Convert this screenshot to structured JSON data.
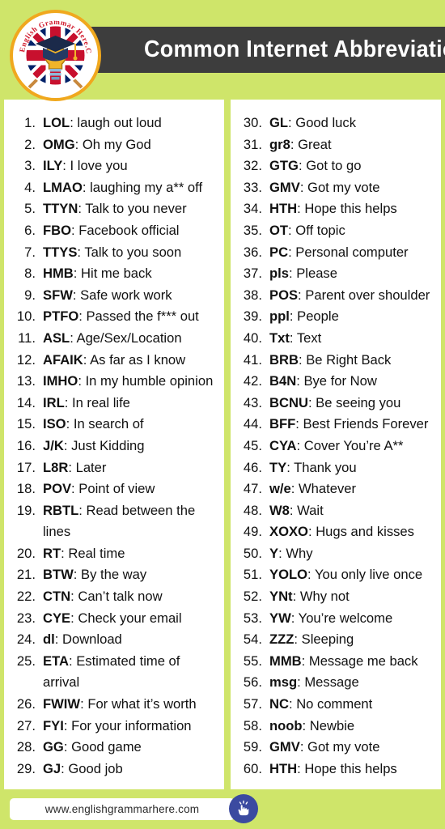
{
  "page": {
    "background_color": "#cfe56a",
    "panel_color": "#ffffff",
    "header_bar_color": "#3d3d3d",
    "accent_color": "#f0a81e",
    "badge_color": "#3b4aa0"
  },
  "header": {
    "title": "Common Internet Abbreviations",
    "logo": {
      "name": "english-grammar-here-logo",
      "text": "English Grammar Here.Com"
    }
  },
  "footer": {
    "url": "www.englishgrammarhere.com",
    "icon": "click-hand-icon"
  },
  "columns": [
    {
      "id": "left-column",
      "items": [
        {
          "num": "1.",
          "abbr": "LOL",
          "meaning": "laugh out loud"
        },
        {
          "num": "2.",
          "abbr": "OMG",
          "meaning": "Oh my God"
        },
        {
          "num": "3.",
          "abbr": "ILY",
          "meaning": "I love you"
        },
        {
          "num": "4.",
          "abbr": "LMAO",
          "meaning": "laughing my a** off"
        },
        {
          "num": "5.",
          "abbr": "TTYN",
          "meaning": "Talk to you never"
        },
        {
          "num": "6.",
          "abbr": "FBO",
          "meaning": "Facebook official"
        },
        {
          "num": "7.",
          "abbr": "TTYS",
          "meaning": "Talk to you soon"
        },
        {
          "num": "8.",
          "abbr": "HMB",
          "meaning": "Hit me back"
        },
        {
          "num": "9.",
          "abbr": "SFW",
          "meaning": "Safe work work"
        },
        {
          "num": "10.",
          "abbr": "PTFO",
          "meaning": "Passed the f*** out"
        },
        {
          "num": "11.",
          "abbr": "ASL",
          "meaning": "Age/Sex/Location"
        },
        {
          "num": "12.",
          "abbr": "AFAIK",
          "meaning": "As far as I know"
        },
        {
          "num": "13.",
          "abbr": "IMHO",
          "meaning": "In my humble opinion"
        },
        {
          "num": "14.",
          "abbr": "IRL",
          "meaning": "In real life"
        },
        {
          "num": "15.",
          "abbr": "ISO",
          "meaning": "In search of"
        },
        {
          "num": "16.",
          "abbr": "J/K",
          "meaning": "Just Kidding"
        },
        {
          "num": "17.",
          "abbr": "L8R",
          "meaning": "Later"
        },
        {
          "num": "18.",
          "abbr": "POV",
          "meaning": "Point of view"
        },
        {
          "num": "19.",
          "abbr": "RBTL",
          "meaning": "Read between the lines"
        },
        {
          "num": "20.",
          "abbr": "RT",
          "meaning": "Real time"
        },
        {
          "num": "21.",
          "abbr": "BTW",
          "meaning": "By the way"
        },
        {
          "num": "22.",
          "abbr": "CTN",
          "meaning": "Can’t talk now"
        },
        {
          "num": "23.",
          "abbr": "CYE",
          "meaning": "Check your email"
        },
        {
          "num": "24.",
          "abbr": "dl",
          "meaning": "Download"
        },
        {
          "num": "25.",
          "abbr": "ETA",
          "meaning": "Estimated time of arrival"
        },
        {
          "num": "26.",
          "abbr": "FWIW",
          "meaning": "For what it’s worth"
        },
        {
          "num": "27.",
          "abbr": "FYI",
          "meaning": "For your information"
        },
        {
          "num": "28.",
          "abbr": "GG",
          "meaning": "Good game"
        },
        {
          "num": "29.",
          "abbr": "GJ",
          "meaning": "Good job"
        }
      ]
    },
    {
      "id": "right-column",
      "items": [
        {
          "num": "30.",
          "abbr": "GL",
          "meaning": "Good luck"
        },
        {
          "num": "31.",
          "abbr": "gr8",
          "meaning": "Great"
        },
        {
          "num": "32.",
          "abbr": "GTG",
          "meaning": "Got to go"
        },
        {
          "num": "33.",
          "abbr": "GMV",
          "meaning": "Got my vote"
        },
        {
          "num": "34.",
          "abbr": "HTH",
          "meaning": "Hope this helps"
        },
        {
          "num": "35.",
          "abbr": "OT",
          "meaning": "Off topic"
        },
        {
          "num": "36.",
          "abbr": "PC",
          "meaning": "Personal computer"
        },
        {
          "num": "37.",
          "abbr": "pls",
          "meaning": "Please"
        },
        {
          "num": "38.",
          "abbr": "POS",
          "meaning": "Parent over shoulder"
        },
        {
          "num": "39.",
          "abbr": "ppl",
          "meaning": "People"
        },
        {
          "num": "40.",
          "abbr": "Txt",
          "meaning": "Text"
        },
        {
          "num": "41.",
          "abbr": "BRB",
          "meaning": "Be Right Back"
        },
        {
          "num": "42.",
          "abbr": "B4N",
          "meaning": "Bye for Now"
        },
        {
          "num": "43.",
          "abbr": "BCNU",
          "meaning": "Be seeing you"
        },
        {
          "num": "44.",
          "abbr": "BFF",
          "meaning": "Best Friends Forever"
        },
        {
          "num": "45.",
          "abbr": "CYA",
          "meaning": "Cover You’re A**"
        },
        {
          "num": "46.",
          "abbr": "TY",
          "meaning": "Thank you"
        },
        {
          "num": "47.",
          "abbr": "w/e",
          "meaning": "Whatever"
        },
        {
          "num": "48.",
          "abbr": "W8",
          "meaning": "Wait"
        },
        {
          "num": "49.",
          "abbr": "XOXO",
          "meaning": "Hugs and kisses"
        },
        {
          "num": "50.",
          "abbr": "Y",
          "meaning": "Why"
        },
        {
          "num": "51.",
          "abbr": "YOLO",
          "meaning": "You only live once"
        },
        {
          "num": "52.",
          "abbr": "YNt",
          "meaning": "Why not"
        },
        {
          "num": "53.",
          "abbr": "YW",
          "meaning": "You’re welcome"
        },
        {
          "num": "54.",
          "abbr": "ZZZ",
          "meaning": "Sleeping"
        },
        {
          "num": "55.",
          "abbr": "MMB",
          "meaning": "Message me back"
        },
        {
          "num": "56.",
          "abbr": "msg",
          "meaning": "Message"
        },
        {
          "num": "57.",
          "abbr": "NC",
          "meaning": "No comment"
        },
        {
          "num": "58.",
          "abbr": "noob",
          "meaning": "Newbie"
        },
        {
          "num": "59.",
          "abbr": "GMV",
          "meaning": "Got my vote"
        },
        {
          "num": "60.",
          "abbr": "HTH",
          "meaning": "Hope this helps"
        }
      ]
    }
  ]
}
